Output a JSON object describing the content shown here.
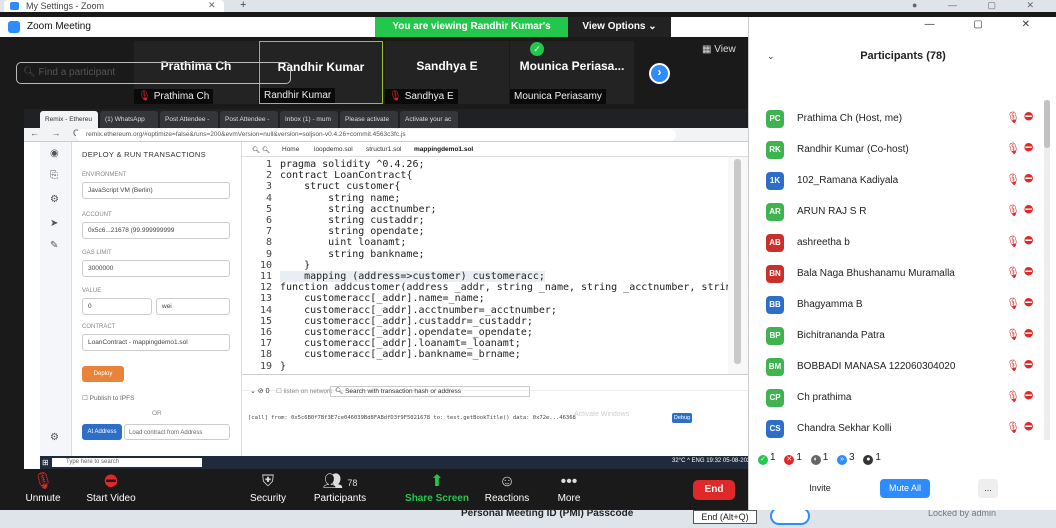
{
  "browser_tab": {
    "title": "My Settings - Zoom"
  },
  "zoom": {
    "window_title": "Zoom Meeting",
    "banner": "You are viewing Randhir Kumar's screen",
    "view_options": "View Options ⌄",
    "view_label": "View"
  },
  "thumbnails": [
    {
      "name": "Prathima Ch",
      "label": "Prathima Ch",
      "muted": true
    },
    {
      "name": "Randhir Kumar",
      "label": "Randhir Kumar",
      "muted": false
    },
    {
      "name": "Sandhya E",
      "label": "Sandhya E",
      "muted": true
    },
    {
      "name": "Mounica Periasa...",
      "label": "Mounica Periasamy",
      "muted": false
    }
  ],
  "chrome": {
    "tabs": [
      "Remix - Ethereu",
      "(1) WhatsApp",
      "Post Attendee -",
      "Post Attendee - ",
      "Inbox (1) - mum",
      "Please activate",
      "Activate your ac"
    ],
    "url": "remix.ethereum.org/#optimize=false&runs=200&evmVersion=null&version=soljson-v0.4.26+commit.4563c3fc.js"
  },
  "deploy": {
    "header": "DEPLOY & RUN TRANSACTIONS",
    "environment_label": "ENVIRONMENT",
    "environment": "JavaScript VM (Berlin)",
    "account_label": "ACCOUNT",
    "account": "0x5c6...21678 (99.999999999",
    "gas_label": "GAS LIMIT",
    "gas": "3000000",
    "value_label": "VALUE",
    "value": "0",
    "unit": "wei",
    "contract_label": "CONTRACT",
    "contract": "LoanContract - mappingdemo1.sol",
    "deploy_btn": "Deploy",
    "publish": "Publish to IPFS",
    "or": "OR",
    "at_address_btn": "At Address",
    "load_placeholder": "Load contract from Address"
  },
  "editor": {
    "tabs": [
      "Home",
      "loopdemo.sol",
      "structur1.sol",
      "mappingdemo1.sol"
    ],
    "lines": [
      {
        "n": "1",
        "code": "pragma solidity ^0.4.26;"
      },
      {
        "n": "2",
        "code": "contract LoanContract{"
      },
      {
        "n": "3",
        "code": "    struct customer{"
      },
      {
        "n": "4",
        "code": "        string name;"
      },
      {
        "n": "5",
        "code": "        string acctnumber;"
      },
      {
        "n": "6",
        "code": "        string custaddr;"
      },
      {
        "n": "7",
        "code": "        string opendate;"
      },
      {
        "n": "8",
        "code": "        uint loanamt;"
      },
      {
        "n": "9",
        "code": "        string bankname;"
      },
      {
        "n": "10",
        "code": "    }"
      },
      {
        "n": "11",
        "code": "    mapping (address=>customer) customeracc;"
      },
      {
        "n": "12",
        "code": "function addcustomer(address _addr, string _name, string _acctnumber, string"
      },
      {
        "n": "13",
        "code": "    customeracc[_addr].name=_name;"
      },
      {
        "n": "14",
        "code": "    customeracc[_addr].acctnumber=_acctnumber;"
      },
      {
        "n": "15",
        "code": "    customeracc[_addr].custaddr=_custaddr;"
      },
      {
        "n": "16",
        "code": "    customeracc[_addr].opendate=_opendate;"
      },
      {
        "n": "17",
        "code": "    customeracc[_addr].loanamt=_loanamt;"
      },
      {
        "n": "18",
        "code": "    customeracc[_addr].bankname=_brname;"
      },
      {
        "n": "19",
        "code": "}"
      }
    ]
  },
  "terminal": {
    "count": "0",
    "listen": "listen on network",
    "search": "Search with transaction hash or address",
    "log": "[call] from: 0x5c6B0f7Bf3E7ce046039Bd8FABdfD3f9F5021678 to: test.getBookTitle() data: 0x72e...46368",
    "debug": "Debug",
    "watermark": "Activate Windows"
  },
  "taskbar": {
    "search": "Type here to search",
    "tray": "32°C  ^  ENG  19:32 05-08-2021"
  },
  "toolbar": {
    "unmute": "Unmute",
    "start_video": "Start Video",
    "security": "Security",
    "participants": "Participants",
    "participants_count": "78",
    "share": "Share Screen",
    "reactions": "Reactions",
    "more": "More",
    "end": "End",
    "end_tip": "End (Alt+Q)"
  },
  "lower": {
    "pmi": "Personal Meeting ID (PMI) Passcode",
    "locked": "Locked by admin"
  },
  "panel": {
    "title": "Participants (78)",
    "search_placeholder": "Find a participant",
    "participants": [
      {
        "initials": "PC",
        "name": "Prathima Ch (Host, me)",
        "color": "#3fb34f"
      },
      {
        "initials": "RK",
        "name": "Randhir Kumar (Co-host)",
        "color": "#3fb34f"
      },
      {
        "initials": "1K",
        "name": "102_Ramana Kadiyala",
        "color": "#2d6ec9"
      },
      {
        "initials": "AR",
        "name": "ARUN RAJ S R",
        "color": "#3fb34f"
      },
      {
        "initials": "AB",
        "name": "ashreetha b",
        "color": "#c9302c"
      },
      {
        "initials": "BN",
        "name": "Bala Naga Bhushanamu Muramalla",
        "color": "#c9302c"
      },
      {
        "initials": "BB",
        "name": "Bhagyamma B",
        "color": "#2d6ec9"
      },
      {
        "initials": "BP",
        "name": "Bichitrananda Patra",
        "color": "#3fb34f"
      },
      {
        "initials": "BM",
        "name": "BOBBADI MANASA 122060304020",
        "color": "#3fb34f"
      },
      {
        "initials": "CP",
        "name": "Ch prathima",
        "color": "#3fb34f"
      },
      {
        "initials": "CS",
        "name": "Chandra Sekhar Kolli",
        "color": "#2d6ec9"
      }
    ],
    "stats": [
      "1",
      "1",
      "1",
      "3",
      "1"
    ],
    "invite": "Invite",
    "mute_all": "Mute All",
    "more": "..."
  }
}
